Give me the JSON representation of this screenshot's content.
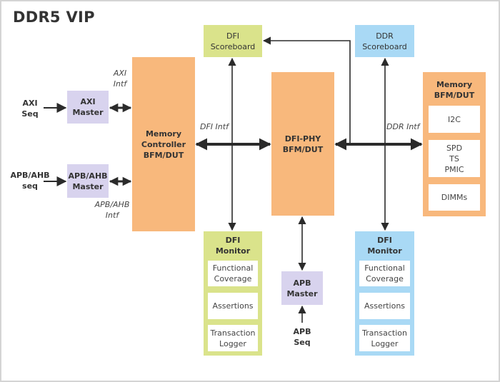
{
  "title": "DDR5 VIP",
  "colors": {
    "master": "#d8d3ee",
    "bfm": "#f8b87c",
    "dfi": "#dae38b",
    "ddr": "#a9d9f5",
    "arrow": "#2b2b2b"
  },
  "inputs": {
    "axi_seq": [
      "AXI",
      "Seq"
    ],
    "apb_ahb_seq": [
      "APB/AHB",
      "seq"
    ],
    "apb_seq": [
      "APB",
      "Seq"
    ]
  },
  "masters": {
    "axi": [
      "AXI",
      "Master"
    ],
    "apb_ahb": [
      "APB/AHB",
      "Master"
    ],
    "apb": [
      "APB",
      "Master"
    ]
  },
  "interfaces": {
    "axi": [
      "AXI",
      "Intf"
    ],
    "apb_ahb": [
      "APB/AHB",
      "Intf"
    ],
    "dfi": "DFI Intf",
    "ddr": "DDR Intf"
  },
  "memory_controller": [
    "Memory",
    "Controller",
    "BFM/DUT"
  ],
  "dfi_phy": [
    "DFI-PHY",
    "BFM/DUT"
  ],
  "memory_bfm": {
    "title": [
      "Memory",
      "BFM/DUT"
    ],
    "blocks": [
      [
        "I2C"
      ],
      [
        "SPD",
        "TS",
        "PMIC"
      ],
      [
        "DIMMs"
      ]
    ]
  },
  "scoreboards": {
    "dfi": [
      "DFI",
      "Scoreboard"
    ],
    "ddr": [
      "DDR",
      "Scoreboard"
    ]
  },
  "monitors": [
    {
      "title": [
        "DFI",
        "Monitor"
      ],
      "blocks": [
        [
          "Functional",
          "Coverage"
        ],
        [
          "Assertions"
        ],
        [
          "Transaction",
          "Logger"
        ]
      ]
    },
    {
      "title": [
        "DFI",
        "Monitor"
      ],
      "blocks": [
        [
          "Functional",
          "Coverage"
        ],
        [
          "Assertions"
        ],
        [
          "Transaction",
          "Logger"
        ]
      ]
    }
  ]
}
